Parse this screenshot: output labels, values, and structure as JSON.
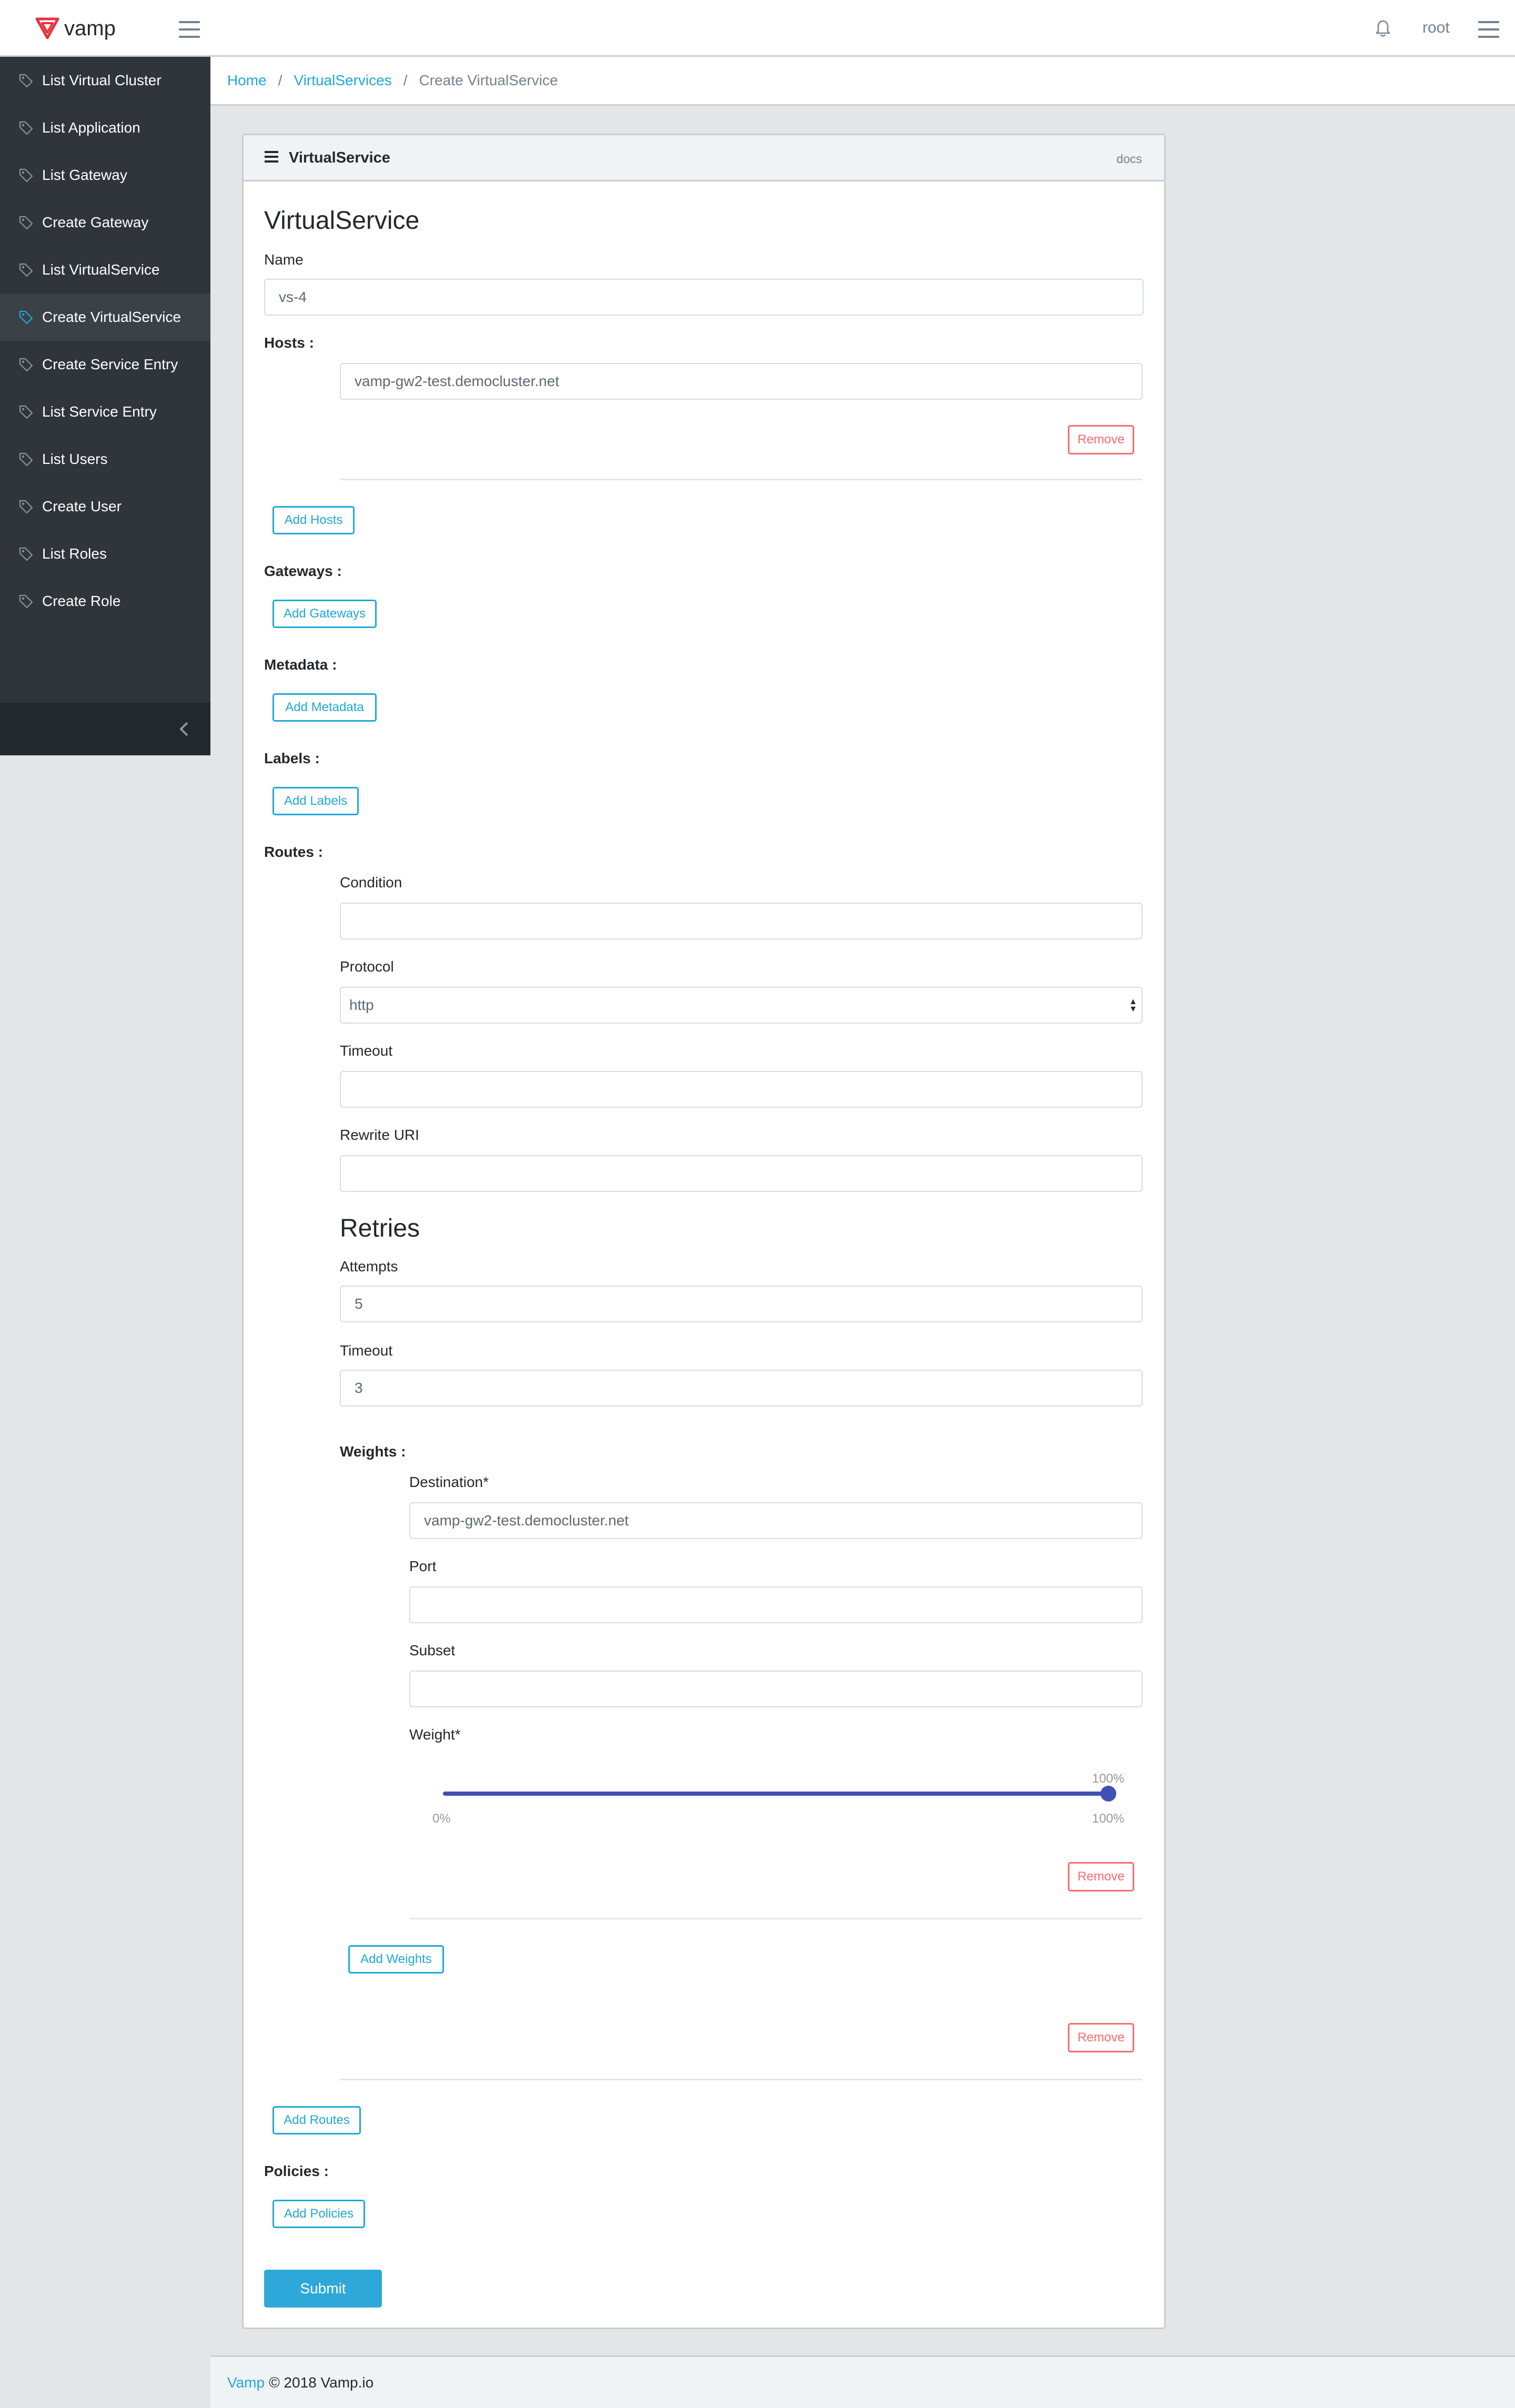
{
  "header": {
    "logo_text": "vamp",
    "user": "root"
  },
  "sidebar": {
    "items": [
      {
        "label": "List Virtual Cluster"
      },
      {
        "label": "List Application"
      },
      {
        "label": "List Gateway"
      },
      {
        "label": "Create Gateway"
      },
      {
        "label": "List VirtualService"
      },
      {
        "label": "Create VirtualService",
        "active": true
      },
      {
        "label": "Create Service Entry"
      },
      {
        "label": "List Service Entry"
      },
      {
        "label": "List Users"
      },
      {
        "label": "Create User"
      },
      {
        "label": "List Roles"
      },
      {
        "label": "Create Role"
      }
    ]
  },
  "breadcrumb": {
    "home": "Home",
    "virtualservices": "VirtualServices",
    "current": "Create VirtualService",
    "sep": "/"
  },
  "card": {
    "header_title": "VirtualService",
    "docs": "docs",
    "form_title": "VirtualService"
  },
  "form": {
    "name_label": "Name",
    "name_value": "vs-4",
    "hosts_label": "Hosts :",
    "host_value": "vamp-gw2-test.democluster.net",
    "remove": "Remove",
    "add_hosts": "Add Hosts",
    "gateways_label": "Gateways :",
    "add_gateways": "Add Gateways",
    "metadata_label": "Metadata :",
    "add_metadata": "Add Metadata",
    "labels_label": "Labels :",
    "add_labels": "Add Labels",
    "routes_label": "Routes :",
    "condition_label": "Condition",
    "condition_value": "",
    "protocol_label": "Protocol",
    "protocol_value": "http",
    "timeout_label": "Timeout",
    "timeout_value": "",
    "rewrite_label": "Rewrite URI",
    "rewrite_value": "",
    "retries_title": "Retries",
    "attempts_label": "Attempts",
    "attempts_value": "5",
    "retry_timeout_label": "Timeout",
    "retry_timeout_value": "3",
    "weights_label": "Weights :",
    "destination_label": "Destination*",
    "destination_value": "vamp-gw2-test.democluster.net",
    "port_label": "Port",
    "port_value": "",
    "subset_label": "Subset",
    "subset_value": "",
    "weight_label": "Weight*",
    "weight_value": 100,
    "weight_current_text": "100%",
    "weight_min_text": "0%",
    "weight_max_text": "100%",
    "add_weights": "Add Weights",
    "add_routes": "Add Routes",
    "policies_label": "Policies :",
    "add_policies": "Add Policies",
    "submit": "Submit"
  },
  "footer": {
    "brand": "Vamp",
    "copyright": "© 2018 Vamp.io"
  },
  "colors": {
    "accent": "#20a8d8",
    "danger": "#f86c6b",
    "sidebar_bg": "#2f353a",
    "slider": "#3f51b5",
    "logo": "#e8323c"
  }
}
